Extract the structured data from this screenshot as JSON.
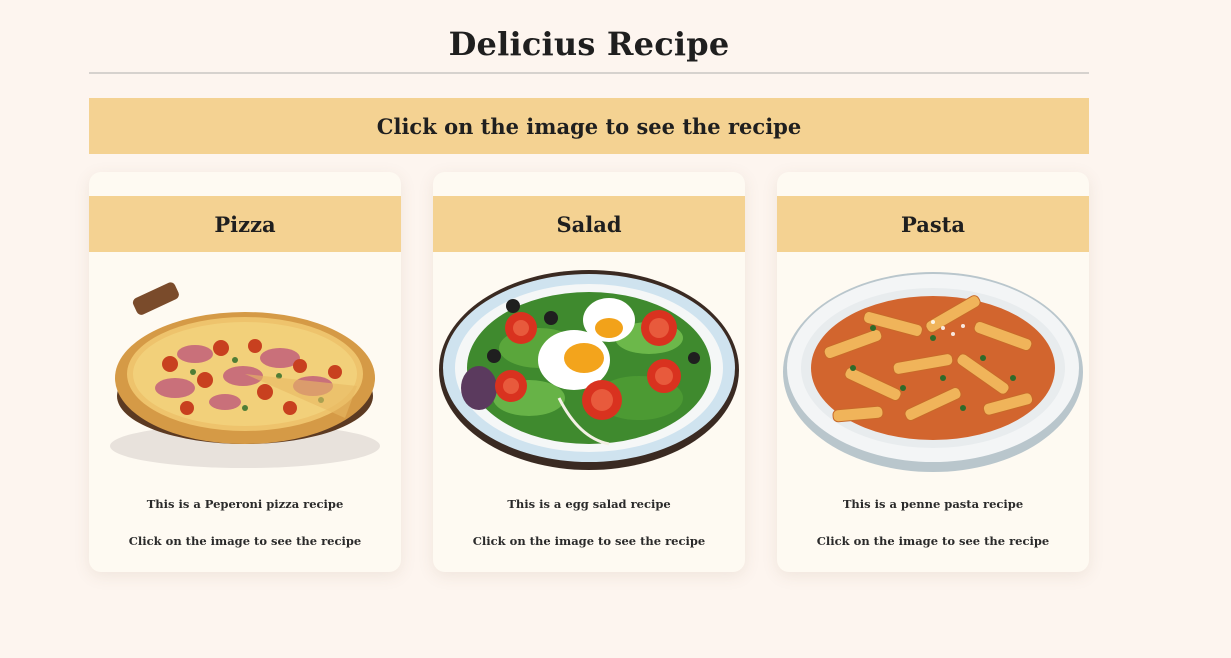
{
  "page": {
    "title": "Delicius Recipe",
    "banner": "Click on the image to see the recipe"
  },
  "cards": [
    {
      "title": "Pizza",
      "image_icon": "pizza-image",
      "description": "This is a Peperoni pizza recipe",
      "hint": "Click on the image to see the recipe"
    },
    {
      "title": "Salad",
      "image_icon": "salad-image",
      "description": "This is a egg salad recipe",
      "hint": "Click on the image to see the recipe"
    },
    {
      "title": "Pasta",
      "image_icon": "pasta-image",
      "description": "This is a penne pasta recipe",
      "hint": "Click on the image to see the recipe"
    }
  ],
  "colors": {
    "background": "#fdf5ef",
    "accent": "#f4d292",
    "card": "#fefaf2"
  }
}
